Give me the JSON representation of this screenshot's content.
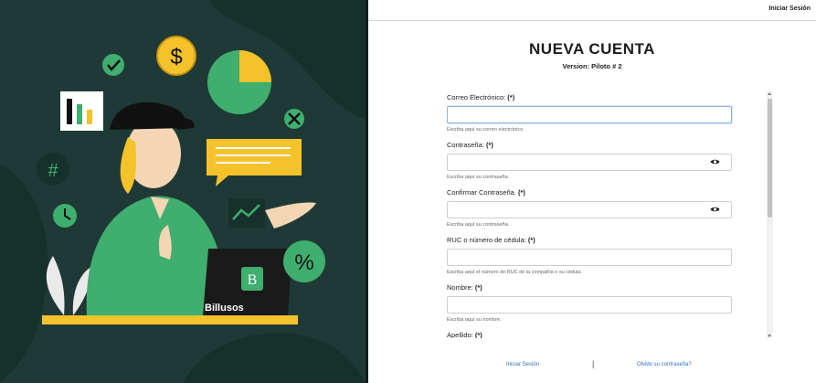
{
  "header": {
    "login_link": "Iniciar Sesión"
  },
  "form": {
    "title": "NUEVA CUENTA",
    "version": "Version: Piloto # 2",
    "fields": [
      {
        "label": "Correo Electrónico:",
        "required": "(*)",
        "help": "Escriba aquí su correo electrónico."
      },
      {
        "label": "Contraseña:",
        "required": "(*)",
        "help": "Escriba aquí su contraseña."
      },
      {
        "label": "Confirmar Contraseña.",
        "required": "(*)",
        "help": "Escriba aquí su contraseña."
      },
      {
        "label": "RUC o número de cédula:",
        "required": "(*)",
        "help": "Escriba aquí el número de RUC de la compañía o su cédula."
      },
      {
        "label": "Nombre:",
        "required": "(*)",
        "help": "Escriba aquí su nombre."
      },
      {
        "label": "Apellido:",
        "required": "(*)"
      }
    ]
  },
  "footer": {
    "login_link": "Iniciar Sesión",
    "separator": "|",
    "forgot_link": "Olvido su contraseña?"
  },
  "illustration": {
    "brand": "Billusos",
    "dollar_symbol": "$",
    "hash_symbol": "#",
    "percent_symbol": "%",
    "logo_letter": "B"
  },
  "colors": {
    "background_dark": "#1f3a36",
    "accent_green": "#3fae6f",
    "accent_yellow": "#f4c22b",
    "link_blue": "#2f6fb3"
  }
}
